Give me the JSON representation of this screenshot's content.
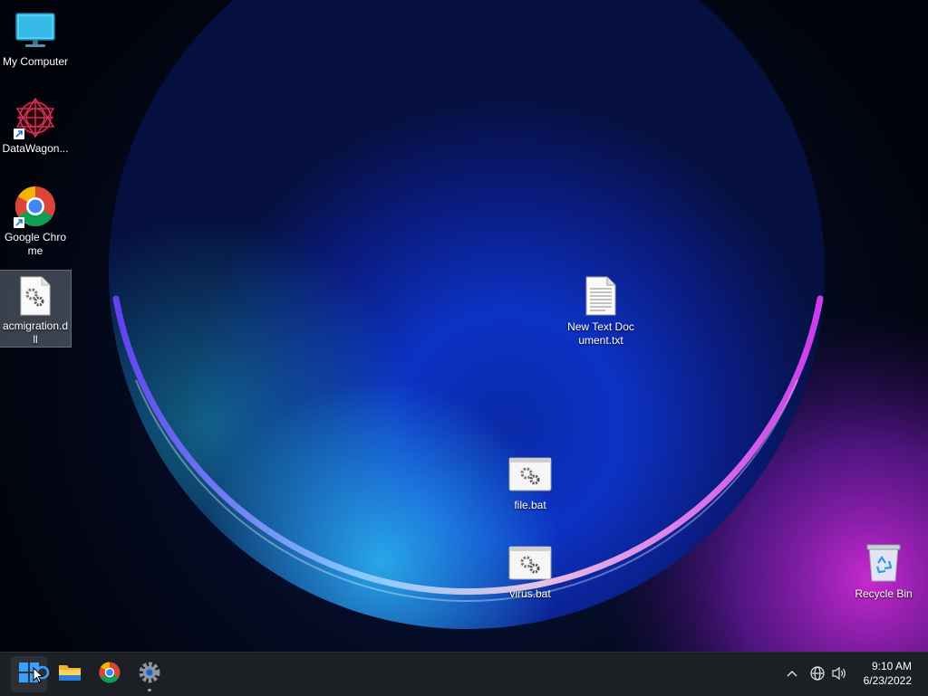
{
  "desktop": {
    "icons": [
      {
        "label": "My Computer",
        "icon": "monitor-icon"
      },
      {
        "label": "DataWagon...",
        "icon": "datawagon-icon",
        "shortcut": true
      },
      {
        "label": "Google Chrome",
        "icon": "chrome-icon",
        "shortcut": true
      },
      {
        "label": "acmigration.dll",
        "icon": "dll-file-icon",
        "selected": true
      },
      {
        "label": "New Text Document.txt",
        "icon": "text-file-icon"
      },
      {
        "label": "file.bat",
        "icon": "batch-file-icon"
      },
      {
        "label": "virus.bat",
        "icon": "batch-file-icon"
      },
      {
        "label": "Recycle Bin",
        "icon": "recycle-bin-icon"
      }
    ]
  },
  "taskbar": {
    "items": [
      "start-icon",
      "search-icon",
      "file-explorer-icon",
      "chrome-icon",
      "settings-icon"
    ],
    "tray": [
      "chevron-up-icon",
      "network-globe-icon",
      "speaker-icon"
    ],
    "time": "9:10 AM",
    "date": "6/23/2022"
  },
  "colors": {
    "taskbar_bg": "#1c1f24",
    "wallpaper_blue": "#1a3cff",
    "wallpaper_pink": "#d22bd8"
  }
}
